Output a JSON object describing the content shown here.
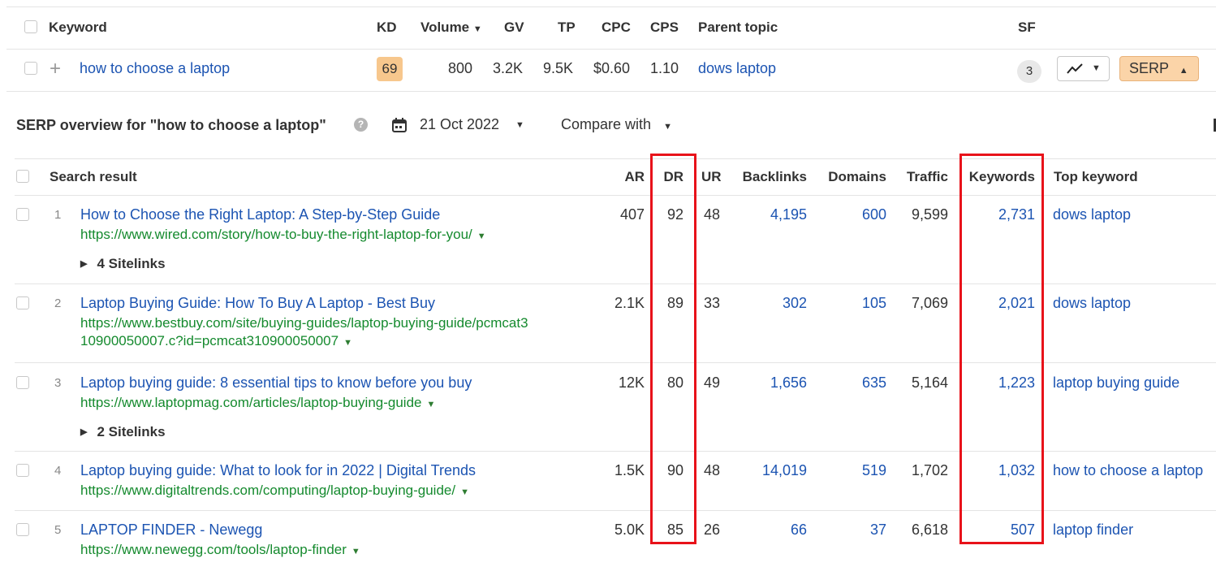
{
  "keywords_table": {
    "headers": {
      "keyword": "Keyword",
      "kd": "KD",
      "volume": "Volume",
      "gv": "GV",
      "tp": "TP",
      "cpc": "CPC",
      "cps": "CPS",
      "parent_topic": "Parent topic",
      "sf": "SF"
    },
    "row": {
      "keyword": "how to choose a laptop",
      "kd": "69",
      "volume": "800",
      "gv": "3.2K",
      "tp": "9.5K",
      "cpc": "$0.60",
      "cps": "1.10",
      "parent_topic": "dows laptop",
      "sf_count": "3",
      "serp_button": "SERP"
    }
  },
  "serp_overview": {
    "title": "SERP overview for \"how to choose a laptop\"",
    "date": "21 Oct 2022",
    "compare_label": "Compare with",
    "headers": {
      "search_result": "Search result",
      "ar": "AR",
      "dr": "DR",
      "ur": "UR",
      "backlinks": "Backlinks",
      "domains": "Domains",
      "traffic": "Traffic",
      "keywords": "Keywords",
      "top_keyword": "Top keyword"
    },
    "rows": [
      {
        "pos": "1",
        "title": "How to Choose the Right Laptop: A Step-by-Step Guide",
        "url": "https://www.wired.com/story/how-to-buy-the-right-laptop-for-you/",
        "url2": "",
        "ar": "407",
        "dr": "92",
        "ur": "48",
        "backlinks": "4,195",
        "domains": "600",
        "traffic": "9,599",
        "keywords": "2,731",
        "top_keyword": "dows laptop",
        "sitelinks": "4 Sitelinks"
      },
      {
        "pos": "2",
        "title": "Laptop Buying Guide: How To Buy A Laptop - Best Buy",
        "url": "https://www.bestbuy.com/site/buying-guides/laptop-buying-guide/pcmcat3",
        "url2": "10900050007.c?id=pcmcat310900050007",
        "ar": "2.1K",
        "dr": "89",
        "ur": "33",
        "backlinks": "302",
        "domains": "105",
        "traffic": "7,069",
        "keywords": "2,021",
        "top_keyword": "dows laptop",
        "sitelinks": ""
      },
      {
        "pos": "3",
        "title": "Laptop buying guide: 8 essential tips to know before you buy",
        "url": "https://www.laptopmag.com/articles/laptop-buying-guide",
        "url2": "",
        "ar": "12K",
        "dr": "80",
        "ur": "49",
        "backlinks": "1,656",
        "domains": "635",
        "traffic": "5,164",
        "keywords": "1,223",
        "top_keyword": "laptop buying guide",
        "sitelinks": "2 Sitelinks"
      },
      {
        "pos": "4",
        "title": "Laptop buying guide: What to look for in 2022 | Digital Trends",
        "url": "https://www.digitaltrends.com/computing/laptop-buying-guide/",
        "url2": "",
        "ar": "1.5K",
        "dr": "90",
        "ur": "48",
        "backlinks": "14,019",
        "domains": "519",
        "traffic": "1,702",
        "keywords": "1,032",
        "top_keyword": "how to choose a laptop",
        "sitelinks": ""
      },
      {
        "pos": "5",
        "title": "LAPTOP FINDER - Newegg",
        "url": "https://www.newegg.com/tools/laptop-finder",
        "url2": "",
        "ar": "5.0K",
        "dr": "85",
        "ur": "26",
        "backlinks": "66",
        "domains": "37",
        "traffic": "6,618",
        "keywords": "507",
        "top_keyword": "laptop finder",
        "sitelinks": ""
      }
    ]
  },
  "colors": {
    "link": "#1c54b2",
    "url": "#158a2e",
    "highlight": "#e8121a",
    "kd_badge": "#f7c78d",
    "serp_button": "#fbd4a8"
  },
  "icons": [
    "plus-icon",
    "help-icon",
    "calendar-icon",
    "dropdown-caret-icon",
    "trend-chart-icon",
    "expand-triangle-icon"
  ]
}
